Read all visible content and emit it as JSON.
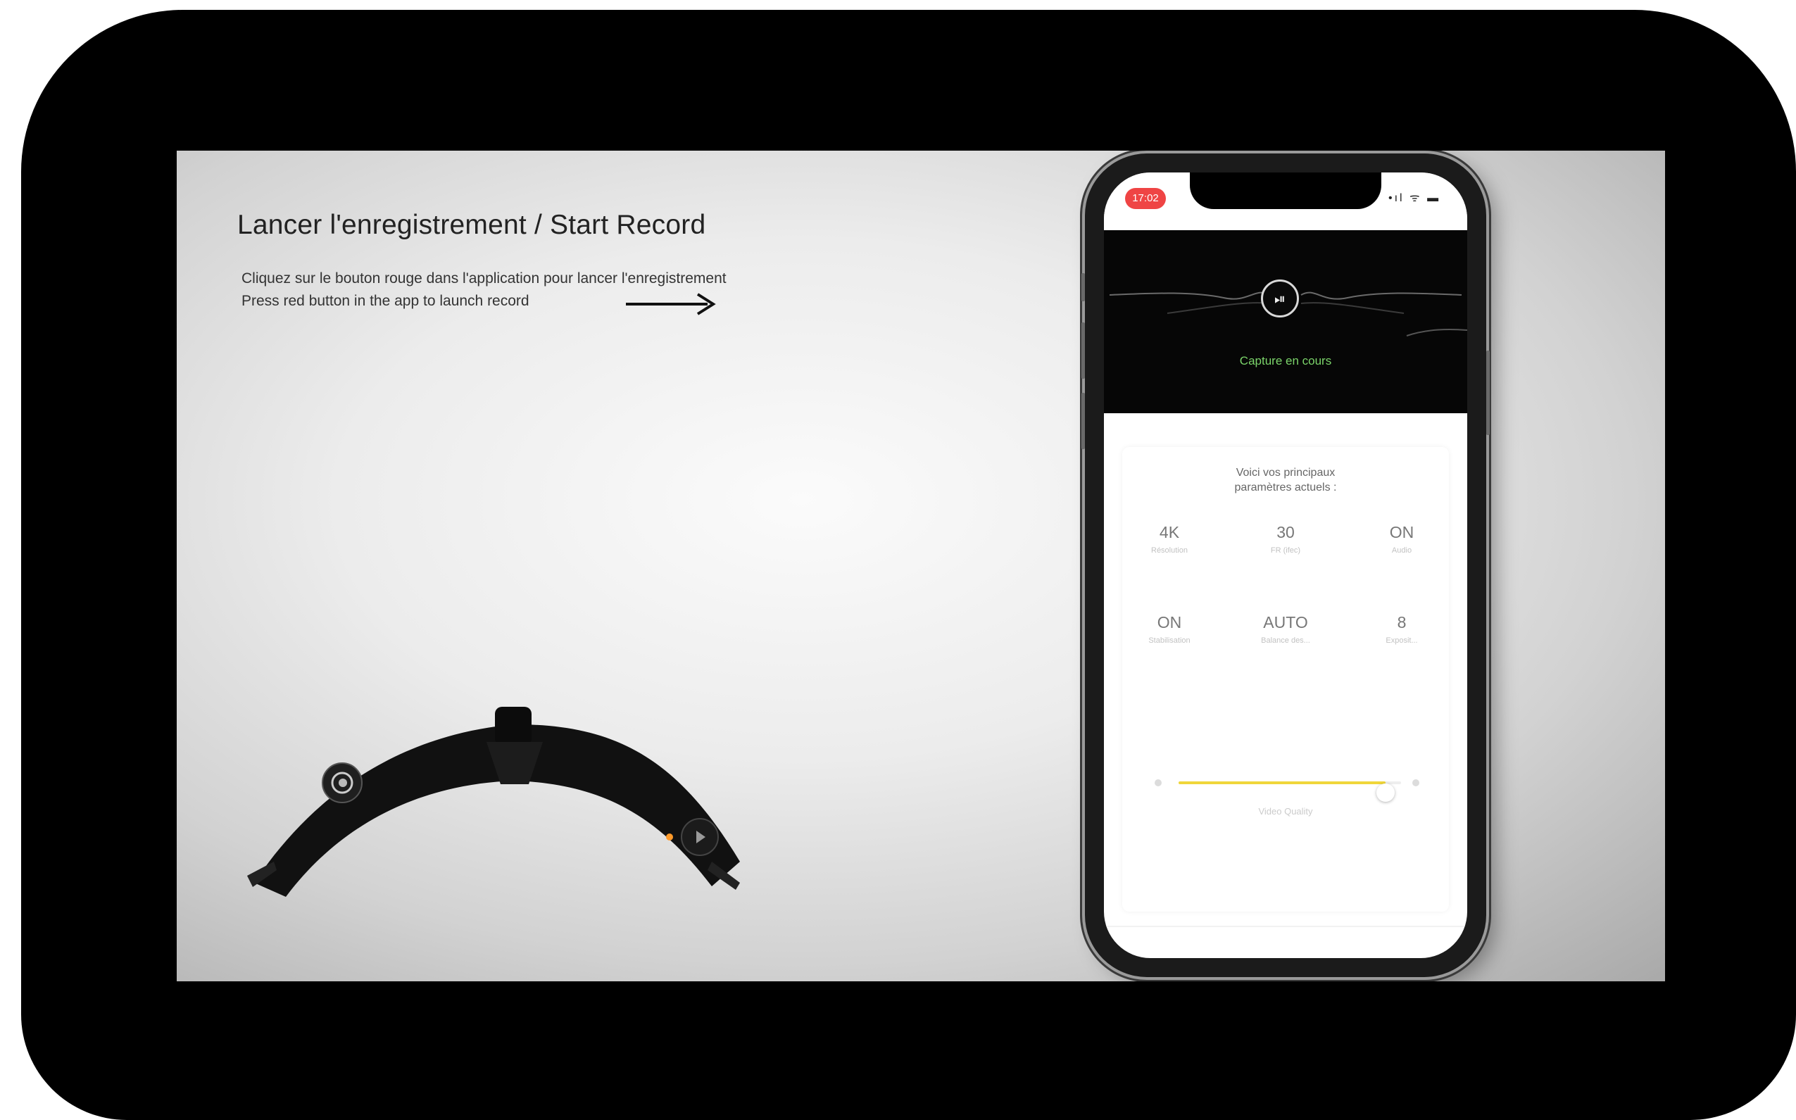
{
  "slide": {
    "title": "Lancer l'enregistrement / Start Record",
    "instruction_fr": "Cliquez sur le bouton rouge dans l'application pour lancer l'enregistrement",
    "instruction_en": "Press red button in the app to launch record"
  },
  "phone": {
    "status_time": "17:02",
    "status_icons": "•ıl ᯤ ▬",
    "play_pause_symbol": "⏯",
    "capture_status": "Capture en cours",
    "settings_heading_line1": "Voici vos principaux",
    "settings_heading_line2": "paramètres actuels :",
    "params": [
      {
        "value": "4K",
        "label": "Résolution"
      },
      {
        "value": "30",
        "label": "FR (ifec)"
      },
      {
        "value": "ON",
        "label": "Audio"
      },
      {
        "value": "ON",
        "label": "Stabilisation"
      },
      {
        "value": "AUTO",
        "label": "Balance des..."
      },
      {
        "value": "8",
        "label": "Exposit..."
      }
    ],
    "video_quality_label": "Video Quality",
    "video_quality_level": 0.93
  },
  "colors": {
    "record_red": "#ef4444",
    "capture_green": "#7bd46a",
    "slider_yellow": "#f0d63a"
  }
}
